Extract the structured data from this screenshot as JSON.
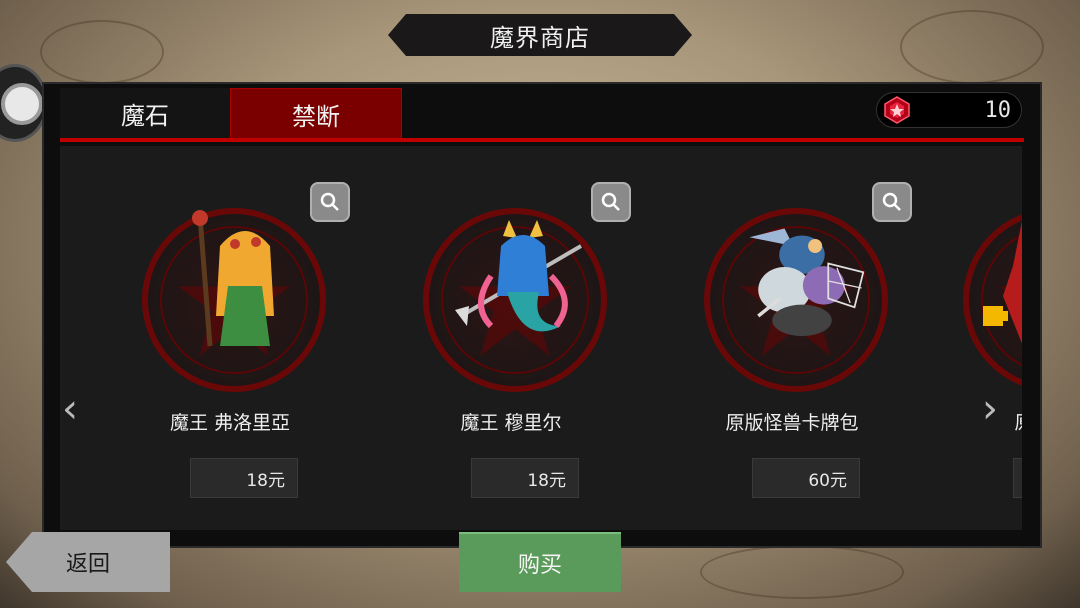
{
  "header": {
    "title": "魔界商店"
  },
  "tabs": [
    {
      "label": "魔石",
      "active": false
    },
    {
      "label": "禁断",
      "active": true
    }
  ],
  "currency": {
    "icon": "red-gem-icon",
    "count": "10"
  },
  "items": [
    {
      "name": "魔王 弗洛里亞",
      "price": "18元",
      "sprite": "demon-lord-floria-sprite",
      "accent": "#4caf50"
    },
    {
      "name": "魔王 穆里尔",
      "price": "18元",
      "sprite": "demon-lord-muriel-sprite",
      "accent": "#3fa9f5"
    },
    {
      "name": "原版怪兽卡牌包",
      "price": "60元",
      "sprite": "monster-card-pack-sprite",
      "accent": "#9fb7d6"
    },
    {
      "name": "原版魔",
      "price": "",
      "sprite": "partial-item-sprite",
      "accent": "#d81b1b"
    }
  ],
  "nav": {
    "prev_arrow": "‹",
    "next_arrow": "›"
  },
  "footer": {
    "back_label": "返回",
    "buy_label": "购买"
  },
  "colors": {
    "tab_active": "#7a0000",
    "underline": "#c00000",
    "buy": "#5a9a5a",
    "back": "#a6a6a6"
  }
}
